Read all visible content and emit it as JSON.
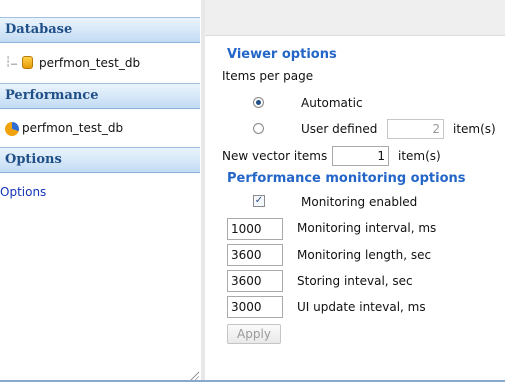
{
  "left_panel": {
    "sections": [
      {
        "title": "Database",
        "item": "perfmon_test_db"
      },
      {
        "title": "Performance",
        "item": "perfmon_test_db"
      },
      {
        "title": "Options",
        "item": "Options"
      }
    ],
    "icons": {
      "database": "database-icon",
      "performance": "performance-pie-icon"
    }
  },
  "viewer_options": {
    "heading": "Viewer options",
    "items_per_page_label": "Items per page",
    "automatic_label": "Automatic",
    "user_defined_label": "User defined",
    "user_defined_value": "2",
    "items_unit": "item(s)",
    "selected": "Automatic",
    "new_vector_label": "New vector items",
    "new_vector_value": "1",
    "new_vector_unit": "item(s)"
  },
  "monitoring_options": {
    "heading": "Performance monitoring options",
    "monitoring_enabled_label": "Monitoring enabled",
    "monitoring_enabled": true,
    "fields": [
      {
        "value": "1000",
        "label": "Monitoring interval, ms"
      },
      {
        "value": "3600",
        "label": "Monitoring length, sec"
      },
      {
        "value": "3600",
        "label": "Storing inteval, sec"
      },
      {
        "value": "3000",
        "label": "UI update inteval, ms"
      }
    ],
    "apply_label": "Apply"
  },
  "colors": {
    "heading": "#2466c8",
    "section_text": "#1f4f86",
    "link": "#1433b8"
  }
}
